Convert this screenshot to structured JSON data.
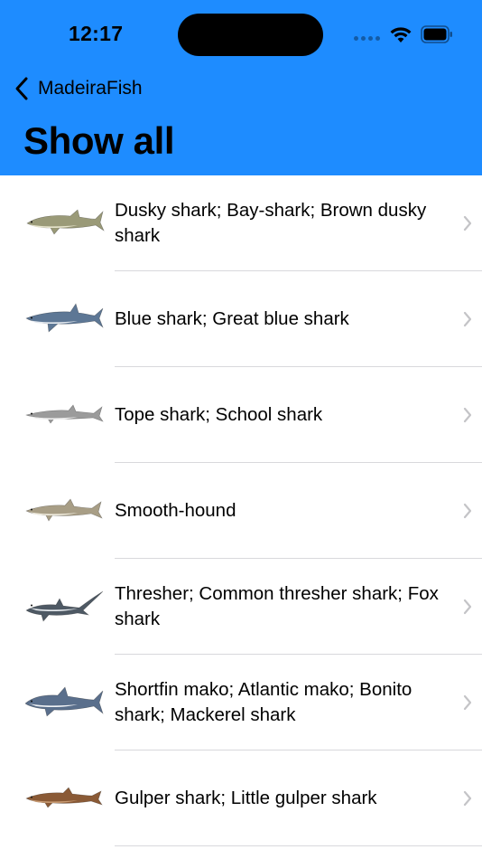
{
  "status": {
    "time": "12:17"
  },
  "nav": {
    "back_label": "MadeiraFish",
    "title": "Show all"
  },
  "fish_list": [
    {
      "name": "Dusky shark; Bay-shark; Brown dusky shark",
      "body_color": "#9a9a78",
      "belly_color": "#e6e4cc"
    },
    {
      "name": "Blue shark; Great blue shark",
      "body_color": "#5d7795",
      "belly_color": "#e3e8ee"
    },
    {
      "name": "Tope shark; School shark",
      "body_color": "#9b9b9b",
      "belly_color": "#ececec"
    },
    {
      "name": "Smooth-hound",
      "body_color": "#a89e86",
      "belly_color": "#eeeadc"
    },
    {
      "name": "Thresher; Common thresher shark; Fox shark",
      "body_color": "#4e5964",
      "belly_color": "#e8ecf0"
    },
    {
      "name": "Shortfin mako; Atlantic mako; Bonito shark; Mackerel shark",
      "body_color": "#5a6f8c",
      "belly_color": "#f0f2f5"
    },
    {
      "name": "Gulper shark; Little gulper shark",
      "body_color": "#8a5a36",
      "belly_color": "#c79a72"
    }
  ],
  "colors": {
    "header_bg": "#1e8cff",
    "separator": "#d8d8dc",
    "chevron": "#c4c4c7"
  }
}
